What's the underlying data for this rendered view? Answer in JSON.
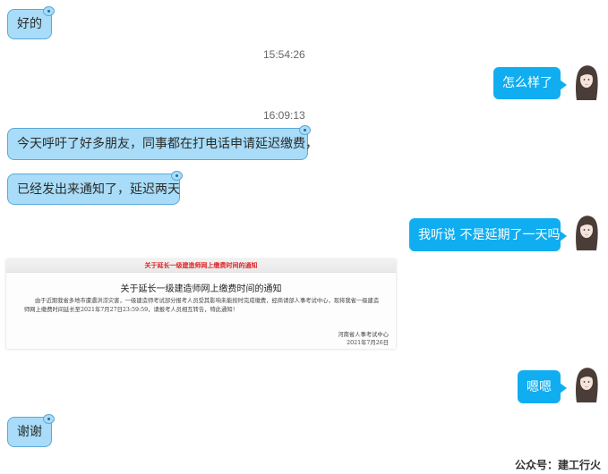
{
  "messages": {
    "m1": "好的",
    "t1": "15:54:26",
    "m2": "怎么样了",
    "t2": "16:09:13",
    "m3": "今天呼吁了好多朋友，同事都在打电话申请延迟缴费，",
    "m4": "已经发出来通知了，延迟两天",
    "m5": "我听说 不是延期了一天吗",
    "m6": "嗯嗯",
    "m7": "谢谢"
  },
  "notice": {
    "header": "关于延长一级建造师网上缴费时间的通知",
    "title": "关于延长一级建造师网上缴费时间的通知",
    "body": "由于近期我省多地市遭遇洪涝灾害，一级建造师考试部分报考人员受其影响未能按时完成缴费，经商请部人事考试中心，现将我省一级建造师网上缴费时间延长至2021年7月27日23:59:59，请报考人员相互转告，特此通知！",
    "signer": "河南省人事考试中心",
    "date": "2021年7月26日"
  },
  "footer": "公众号：建工行火",
  "colors": {
    "in_bubble": "#a8dcf8",
    "out_bubble": "#10aef0"
  }
}
